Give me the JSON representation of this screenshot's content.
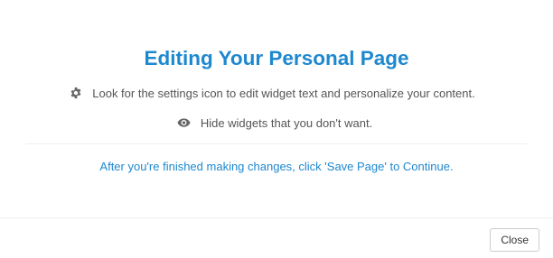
{
  "dialog": {
    "title": "Editing Your Personal Page",
    "tips": [
      {
        "icon": "gear-icon",
        "text": "Look for the settings icon to edit widget text and personalize your content."
      },
      {
        "icon": "eye-icon",
        "text": "Hide widgets that you don't want."
      }
    ],
    "instruction": "After you're finished making changes, click 'Save Page' to Continue.",
    "close_label": "Close"
  },
  "colors": {
    "accent": "#1e88cf",
    "body_text": "#555555",
    "icon": "#666666"
  }
}
